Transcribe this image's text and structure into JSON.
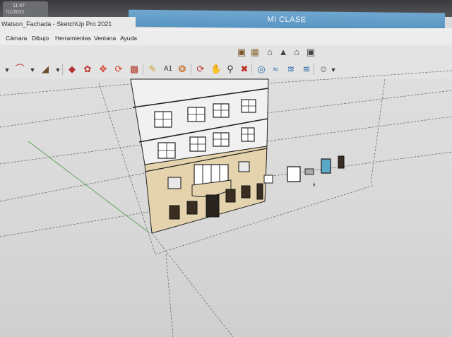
{
  "os": {
    "clock_time": "11:47",
    "clock_date": "/11/2021"
  },
  "window": {
    "title": "Watson_Fachada - SketchUp Pro 2021",
    "class_banner": "MI CLASE"
  },
  "menu": {
    "items": [
      "Cámara",
      "Dibujo",
      "Herramientas",
      "Ventana",
      "Ayuda"
    ]
  },
  "toolbar_top": {
    "icons": [
      "3d-warehouse-icon",
      "components-icon",
      "home-icon",
      "house-top-icon",
      "house-outline-icon",
      "house-bottom-icon"
    ]
  },
  "toolbar_main": {
    "icons": [
      "arc-tool-icon",
      "paint-bucket-icon",
      "push-pull-icon",
      "follow-me-icon",
      "move-icon",
      "rotate-icon",
      "scale-icon",
      "tape-measure-icon",
      "text-tool-icon",
      "paint-icon",
      "orbit-icon",
      "pan-icon",
      "zoom-icon",
      "zoom-extents-icon",
      "sandbox-icon",
      "layers-icon",
      "styles-icon",
      "user-icon"
    ]
  },
  "colors": {
    "accent_banner": "#5f9bc8",
    "facade_ground": "#e4d3ad",
    "facade_upper": "#f1f1f1"
  }
}
